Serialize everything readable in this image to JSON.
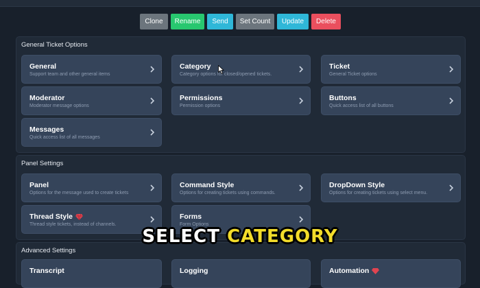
{
  "toolbar": {
    "buttons": [
      {
        "label": "Clone",
        "color": "#6c757d"
      },
      {
        "label": "Rename",
        "color": "#28c76f"
      },
      {
        "label": "Send",
        "color": "#2fb7d8"
      },
      {
        "label": "Set Count",
        "color": "#6c757d"
      },
      {
        "label": "Update",
        "color": "#2fb7d8"
      },
      {
        "label": "Delete",
        "color": "#ea4f5e"
      }
    ]
  },
  "sections": [
    {
      "title": "General Ticket Options",
      "cards": [
        {
          "title": "General",
          "desc": "Support team and other general items"
        },
        {
          "title": "Category",
          "desc": "Category options for closed/opened tickets."
        },
        {
          "title": "Ticket",
          "desc": "General Ticket options"
        },
        {
          "title": "Moderator",
          "desc": "Moderator message options"
        },
        {
          "title": "Permissions",
          "desc": "Permission options"
        },
        {
          "title": "Buttons",
          "desc": "Quick access list of all buttons"
        },
        {
          "title": "Messages",
          "desc": "Quick access list of all messages"
        }
      ]
    },
    {
      "title": "Panel Settings",
      "cards": [
        {
          "title": "Panel",
          "desc": "Options for the message used to create tickets"
        },
        {
          "title": "Command Style",
          "desc": "Options for creating tickets using commands."
        },
        {
          "title": "DropDown Style",
          "desc": "Options for creating tickets using select menu."
        },
        {
          "title": "Thread Style",
          "desc": "Thread style tickets, instead of channels."
        },
        {
          "title": "Forms",
          "desc": "Form Options"
        }
      ]
    },
    {
      "title": "Advanced Settings",
      "cards": [
        {
          "title": "Transcript",
          "desc": ""
        },
        {
          "title": "Logging",
          "desc": ""
        },
        {
          "title": "Automation",
          "desc": ""
        }
      ]
    }
  ],
  "caption": {
    "word1": "SELECT",
    "word2": "CATEGORY"
  },
  "colors": {
    "premium_gem": "#e04450",
    "caption_highlight": "#f3dc2a"
  },
  "icons": [
    "chevron-right-icon",
    "premium-gem-icon",
    "mouse-cursor-icon"
  ]
}
